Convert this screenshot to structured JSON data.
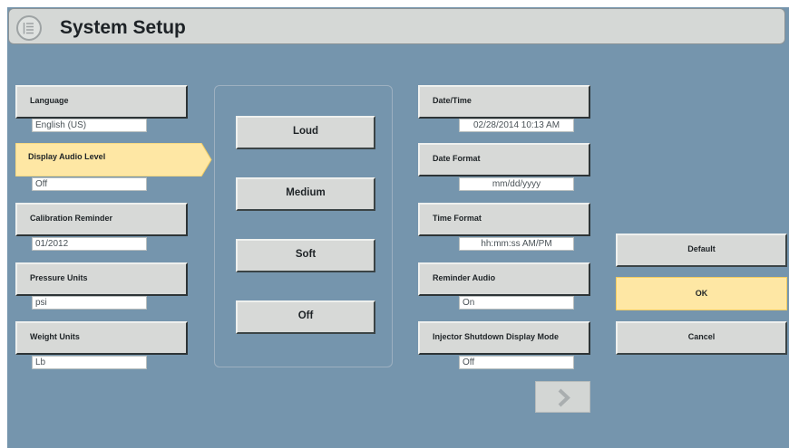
{
  "title": "System Setup",
  "icons": {
    "title_icon": "settings-list-icon",
    "next": "chevron-right-icon"
  },
  "colors": {
    "background": "#7595ad",
    "button": "#d7d9d7",
    "selected": "#fee7a4"
  },
  "left_settings": [
    {
      "label": "Language",
      "value": "English (US)"
    },
    {
      "label": "Display Audio Level",
      "value": "Off",
      "selected": true
    },
    {
      "label": "Calibration Reminder",
      "value": "01/2012"
    },
    {
      "label": "Pressure Units",
      "value": "psi"
    },
    {
      "label": "Weight Units",
      "value": "Lb"
    }
  ],
  "options": [
    "Loud",
    "Medium",
    "Soft",
    "Off"
  ],
  "right_settings": [
    {
      "label": "Date/Time",
      "value": "02/28/2014 10:13 AM"
    },
    {
      "label": "Date Format",
      "value": "mm/dd/yyyy"
    },
    {
      "label": "Time Format",
      "value": "hh:mm:ss AM/PM"
    },
    {
      "label": "Reminder Audio",
      "value": "On"
    },
    {
      "label": "Injector Shutdown Display Mode",
      "value": "Off"
    }
  ],
  "actions": {
    "default": "Default",
    "ok": "OK",
    "cancel": "Cancel"
  }
}
